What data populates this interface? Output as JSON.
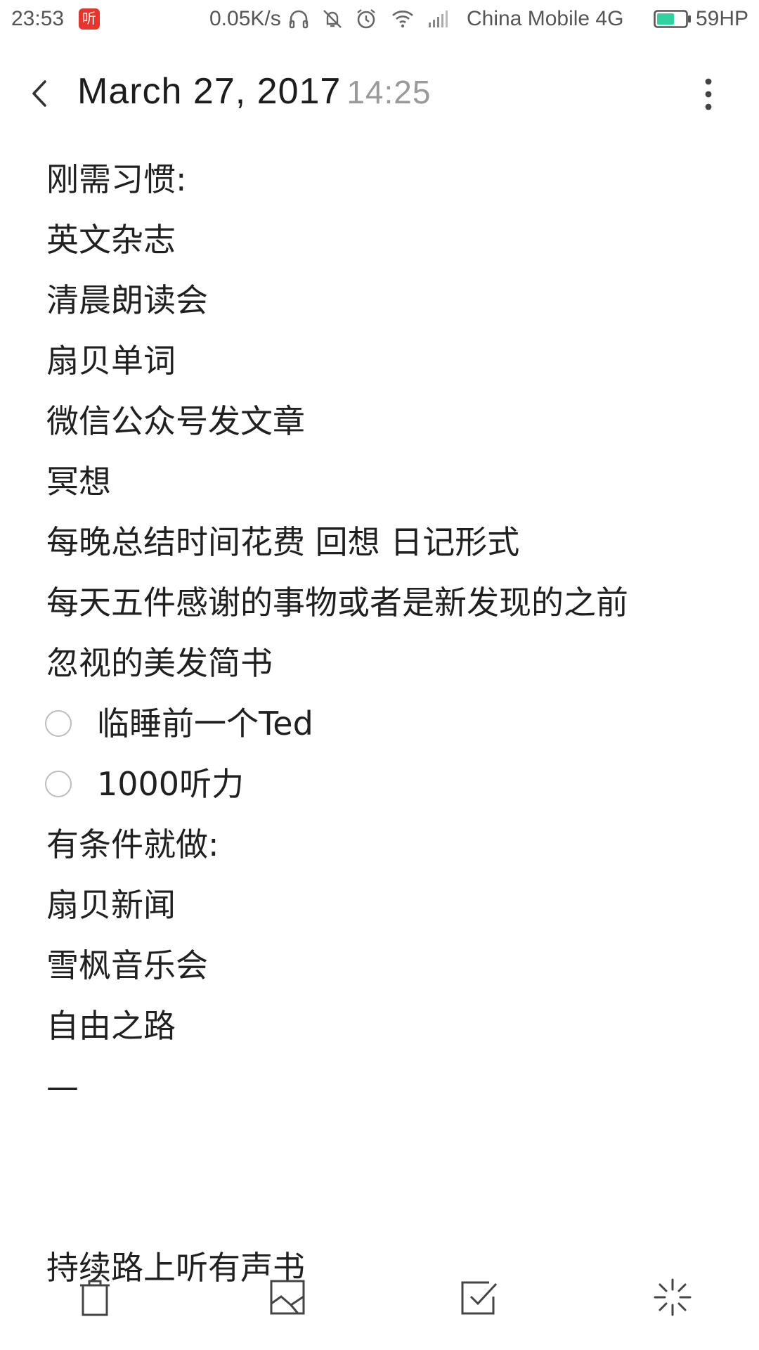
{
  "status_bar": {
    "time": "23:53",
    "app_badge": "听",
    "net_speed": "0.05K/s",
    "carrier": "China Mobile 4G",
    "battery": "59HP",
    "battery_level": 0.59,
    "accent": "#2ed3a0"
  },
  "header": {
    "date": "March  27,  2017",
    "time": "14:25"
  },
  "note": {
    "lines": [
      "刚需习惯:",
      "英文杂志",
      "清晨朗读会",
      "扇贝单词",
      "微信公众号发文章",
      "冥想",
      "每晚总结时间花费 回想 日记形式",
      "每天五件感谢的事物或者是新发现的之前",
      "忽视的美发简书"
    ],
    "checklist": [
      {
        "label": "临睡前一个Ted",
        "checked": false
      },
      {
        "label": "1000听力",
        "checked": false
      }
    ],
    "lines_after": [
      "有条件就做:",
      "扇贝新闻",
      "雪枫音乐会",
      "自由之路",
      "—"
    ],
    "final_line": "持续路上听有声书"
  },
  "toolbar": {
    "icons": [
      "trash-icon",
      "image-icon",
      "checkbox-icon",
      "magic-icon"
    ]
  }
}
